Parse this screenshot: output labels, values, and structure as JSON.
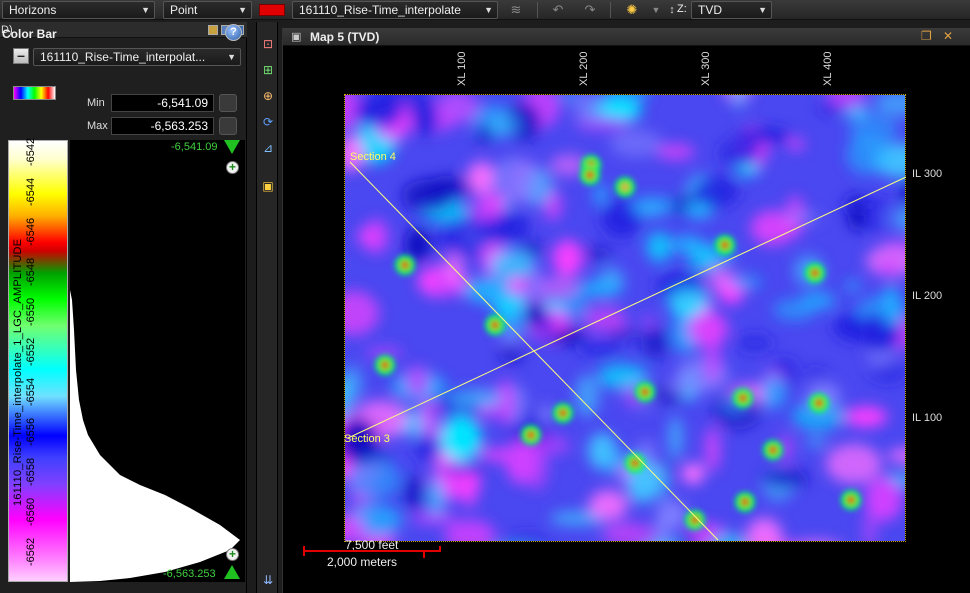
{
  "toolbar": {
    "horizons_combo": "Horizons",
    "mode_combo": "Point",
    "attribute_combo": "161110_Rise-Time_interpolate",
    "z_label": "Z:",
    "z_combo": "TVD"
  },
  "left_panel": {
    "title_fragment": "D)",
    "header": "Color Bar",
    "attribute_select": "161110_Rise-Time_interpolat...",
    "min_label": "Min",
    "min_value": "-6,541.09",
    "max_label": "Max",
    "max_value": "-6,563.253",
    "colorbar_top_value": "-6,541.09",
    "colorbar_bottom_value": "-6,563.253",
    "colorbar_axis_label": "161110_Rise-Time_interpolate_1_LGC_AMPLITUDE",
    "colorbar_ticks": [
      "-6562",
      "-6560",
      "-6558",
      "-6556",
      "-6554",
      "-6552",
      "-6550",
      "-6548",
      "-6546",
      "-6544",
      "-6542"
    ]
  },
  "map": {
    "title": "Map 5 (TVD)",
    "xl_labels": [
      "XL 100",
      "XL 200",
      "XL 300",
      "XL 400"
    ],
    "il_labels": [
      "IL 300",
      "IL 200",
      "IL 100"
    ],
    "section_labels": [
      "Section 4",
      "Section 3"
    ],
    "scale_feet": "7,500 feet",
    "scale_meters": "2,000 meters"
  },
  "colors": {
    "accent_green": "#20c020",
    "section_line": "#ffff80",
    "scale_red": "#e00000"
  },
  "icons": [
    "chevron-down-icon",
    "layers-icon",
    "undo-icon",
    "redo-icon",
    "sun-icon",
    "help-icon",
    "zoom-extent-icon",
    "zoom-icon",
    "rotate-icon",
    "ruler-icon",
    "palette-icon",
    "maximize-icon",
    "close-icon"
  ]
}
